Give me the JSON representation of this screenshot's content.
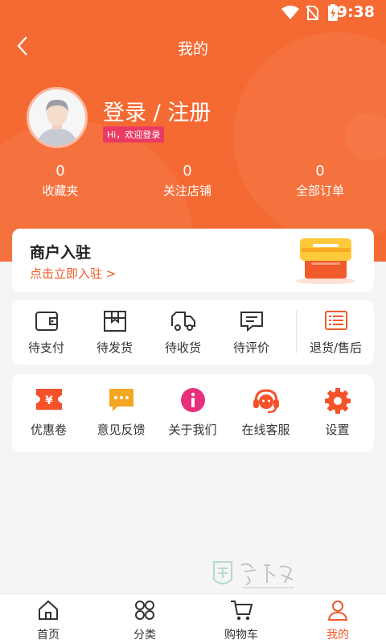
{
  "status_bar": {
    "time": "9:38"
  },
  "nav": {
    "title": "我的"
  },
  "profile": {
    "login_text": "登录 / 注册",
    "welcome_badge": "Hi，欢迎登录"
  },
  "stats": [
    {
      "value": "0",
      "label": "收藏夹"
    },
    {
      "value": "0",
      "label": "关注店铺"
    },
    {
      "value": "0",
      "label": "全部订单"
    }
  ],
  "merchant": {
    "title": "商户入驻",
    "link": "点击立即入驻 >"
  },
  "orders": [
    {
      "label": "待支付",
      "icon": "wallet-icon"
    },
    {
      "label": "待发货",
      "icon": "package-icon"
    },
    {
      "label": "待收货",
      "icon": "truck-icon"
    },
    {
      "label": "待评价",
      "icon": "comment-icon"
    },
    {
      "label": "退货/售后",
      "icon": "return-list-icon"
    }
  ],
  "tools": [
    {
      "label": "优惠卷",
      "icon": "coupon-icon"
    },
    {
      "label": "意见反馈",
      "icon": "feedback-icon"
    },
    {
      "label": "关于我们",
      "icon": "info-icon"
    },
    {
      "label": "在线客服",
      "icon": "customer-service-icon"
    },
    {
      "label": "设置",
      "icon": "gear-icon"
    }
  ],
  "tab_bar": [
    {
      "label": "首页",
      "icon": "home-icon"
    },
    {
      "label": "分类",
      "icon": "category-icon"
    },
    {
      "label": "购物车",
      "icon": "cart-icon"
    },
    {
      "label": "我的",
      "icon": "user-icon",
      "active": true
    }
  ],
  "colors": {
    "primary": "#f56a33",
    "accent": "#f15a2a",
    "badge": "#ea3a64",
    "tool_icon": "#f5522a",
    "feedback_icon": "#f5a623",
    "info_icon": "#e8307a"
  }
}
